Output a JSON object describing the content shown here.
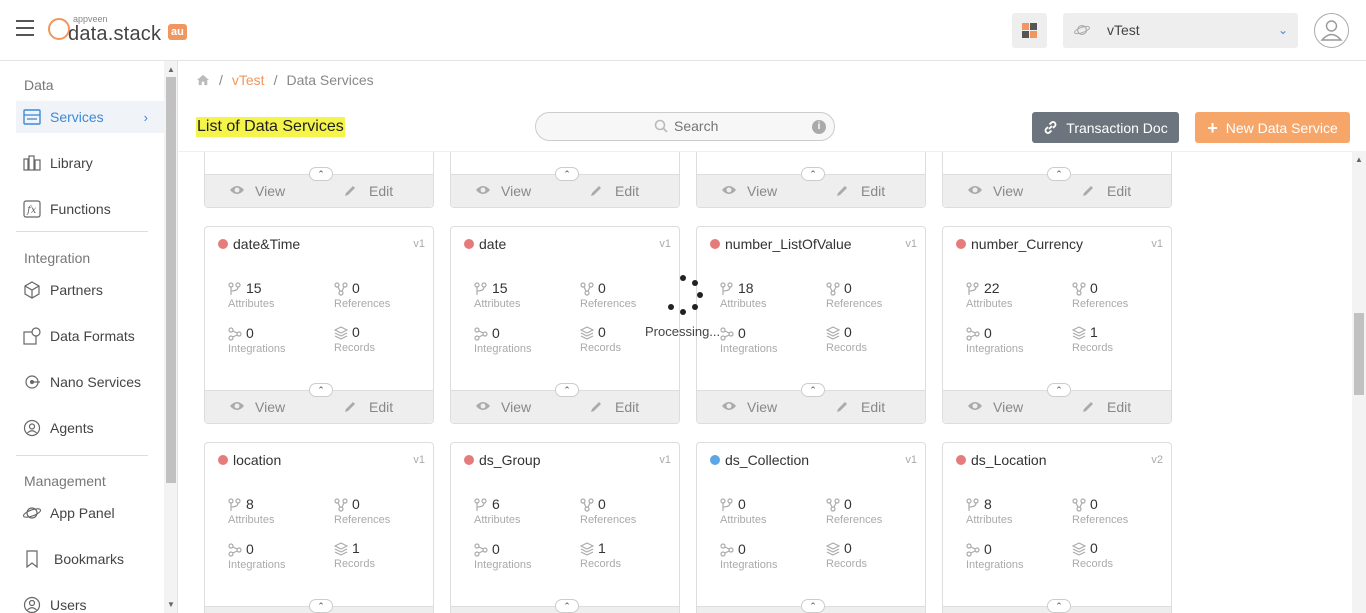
{
  "header": {
    "logo_small": "appveen",
    "logo_main": "data.stack",
    "logo_badge": "au",
    "app_selected": "vTest"
  },
  "sidebar": {
    "sections": [
      {
        "title": "Data"
      },
      {
        "title": "Integration"
      },
      {
        "title": "Management"
      }
    ],
    "items": [
      {
        "label": "Services",
        "icon": "services-icon",
        "active": true
      },
      {
        "label": "Library",
        "icon": "library-icon"
      },
      {
        "label": "Functions",
        "icon": "functions-icon"
      },
      {
        "label": "Partners",
        "icon": "partners-icon"
      },
      {
        "label": "Data Formats",
        "icon": "data-formats-icon"
      },
      {
        "label": "Nano Services",
        "icon": "nano-services-icon"
      },
      {
        "label": "Agents",
        "icon": "agents-icon"
      },
      {
        "label": "App Panel",
        "icon": "app-panel-icon"
      },
      {
        "label": "Bookmarks",
        "icon": "bookmarks-icon"
      },
      {
        "label": "Users",
        "icon": "users-icon"
      }
    ]
  },
  "breadcrumb": {
    "app": "vTest",
    "current": "Data Services",
    "sep": "/"
  },
  "page": {
    "title": "List of Data Services",
    "search_placeholder": "Search",
    "transaction_doc": "Transaction Doc",
    "new_service": "New Data Service"
  },
  "card_labels": {
    "attributes": "Attributes",
    "references": "References",
    "integrations": "Integrations",
    "records": "Records",
    "view": "View",
    "edit": "Edit"
  },
  "cards": [
    {
      "name": "date&Time",
      "version": "v1",
      "status_color": "#e57b7b",
      "attributes": "15",
      "references": "0",
      "integrations": "0",
      "records": "0"
    },
    {
      "name": "date",
      "version": "v1",
      "status_color": "#e57b7b",
      "attributes": "15",
      "references": "0",
      "integrations": "0",
      "records": "0"
    },
    {
      "name": "number_ListOfValue",
      "version": "v1",
      "status_color": "#e57b7b",
      "attributes": "18",
      "references": "0",
      "integrations": "0",
      "records": "0"
    },
    {
      "name": "number_Currency",
      "version": "v1",
      "status_color": "#e57b7b",
      "attributes": "22",
      "references": "0",
      "integrations": "0",
      "records": "1"
    },
    {
      "name": "location",
      "version": "v1",
      "status_color": "#e57b7b",
      "attributes": "8",
      "references": "0",
      "integrations": "0",
      "records": "1"
    },
    {
      "name": "ds_Group",
      "version": "v1",
      "status_color": "#e57b7b",
      "attributes": "6",
      "references": "0",
      "integrations": "0",
      "records": "1"
    },
    {
      "name": "ds_Collection",
      "version": "v1",
      "status_color": "#5aa6e6",
      "attributes": "0",
      "references": "0",
      "integrations": "0",
      "records": "0"
    },
    {
      "name": "ds_Location",
      "version": "v2",
      "status_color": "#e57b7b",
      "attributes": "8",
      "references": "0",
      "integrations": "0",
      "records": "0"
    }
  ],
  "loading": {
    "text": "Processing..."
  }
}
